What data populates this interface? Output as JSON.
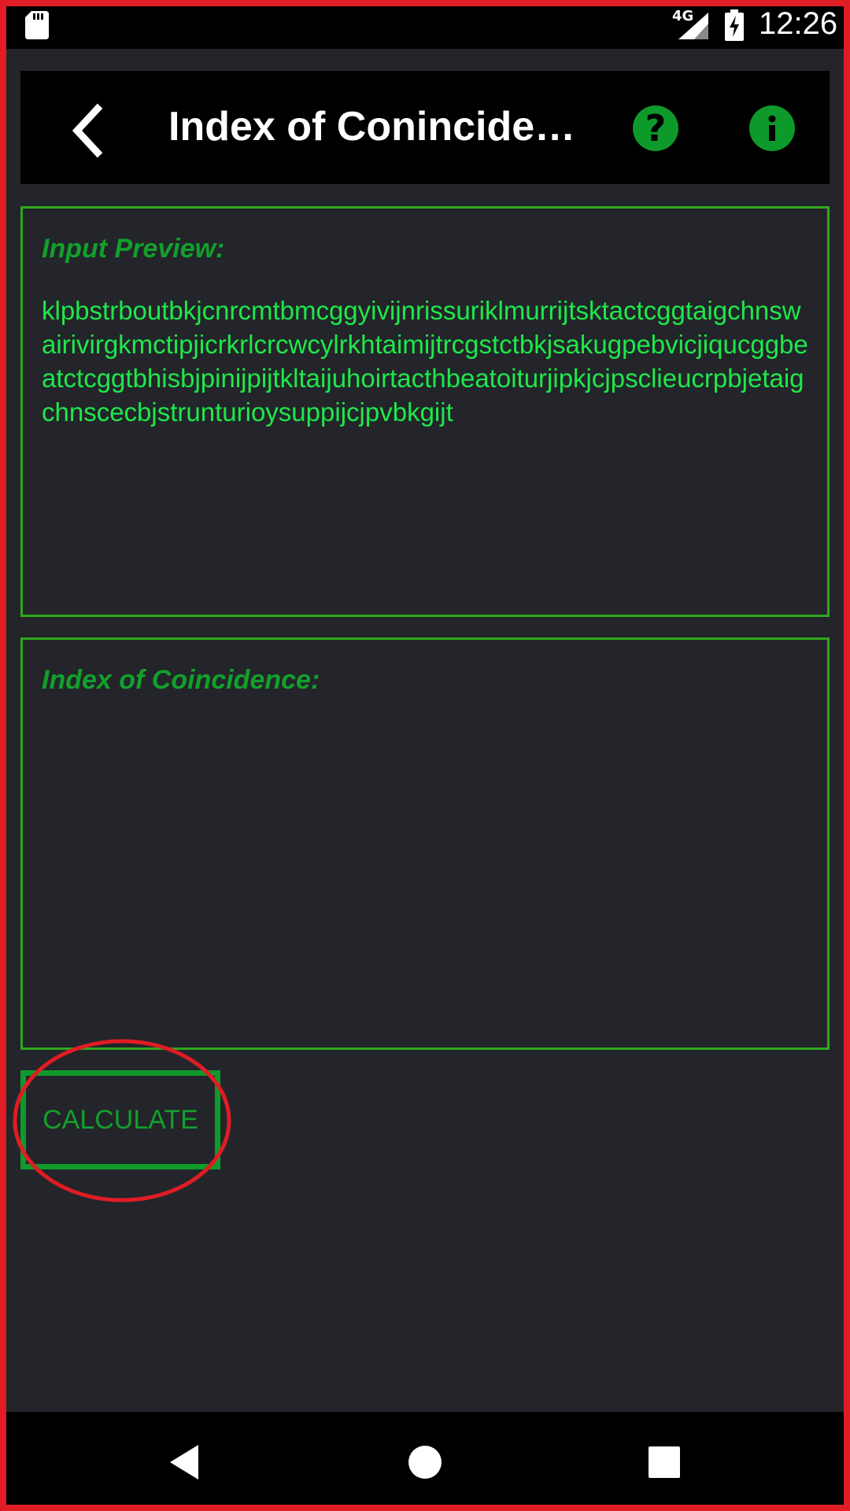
{
  "status_bar": {
    "network": "4G",
    "time": "12:26",
    "icons": [
      "sd-card-icon",
      "signal-icon",
      "battery-charging-icon"
    ]
  },
  "toolbar": {
    "title": "Index of Coninciden…",
    "icons": [
      "back-arrow-icon",
      "help-icon",
      "info-icon"
    ],
    "icon_color": "#0e9a2a"
  },
  "input_panel": {
    "label": "Input Preview:",
    "text": "klpbstrboutbkjcnrcmtbmcggyivijnrissuriklmurrijtsktactcggtaigchnswairivirgkmctipjicrkrlcrcwcylrkhtaimijtrcgstctbkjsakugpebvicjiqucggbeatctcggtbhisbjpinijpijtkltaijuhoirtacthbeatoiturjipkjcjpsclieucrpbjetaigchnscecbjstrunturioysuppijcjpvbkgijt"
  },
  "result_panel": {
    "label": "Index of Coincidence:",
    "value": ""
  },
  "calculate_button": {
    "label": "CALCULATE"
  },
  "nav_bar": {
    "icons": [
      "nav-back-icon",
      "nav-home-icon",
      "nav-recents-icon"
    ]
  },
  "colors": {
    "background": "#23252a",
    "accent_green": "#12a02c",
    "text_green": "#1ee84a",
    "panel_border": "#2ea81e",
    "annotation_red": "#e01c24"
  }
}
